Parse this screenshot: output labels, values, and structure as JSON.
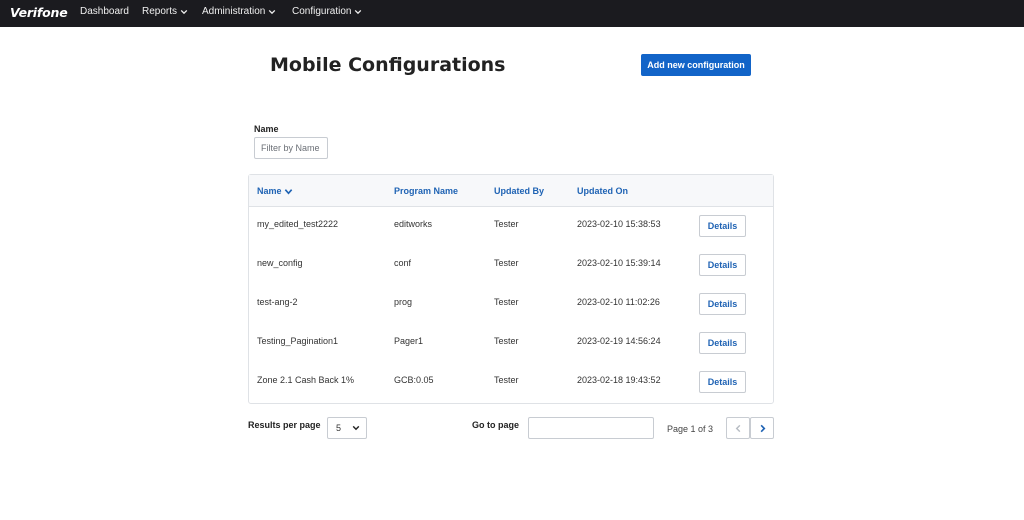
{
  "nav": {
    "logo": "Verifone",
    "items": [
      {
        "label": "Dashboard",
        "dropdown": false
      },
      {
        "label": "Reports",
        "dropdown": true
      },
      {
        "label": "Administration",
        "dropdown": true
      },
      {
        "label": "Configuration",
        "dropdown": true
      }
    ]
  },
  "header": {
    "title": "Mobile Configurations",
    "add_button": "Add new configuration"
  },
  "filter": {
    "label": "Name",
    "placeholder": "Filter by Name",
    "value": ""
  },
  "table": {
    "columns": [
      "Name",
      "Program Name",
      "Updated By",
      "Updated On"
    ],
    "sort_column": "Name",
    "sort_direction": "descending",
    "details_label": "Details",
    "rows": [
      {
        "name": "my_edited_test2222",
        "program": "editworks",
        "updated_by": "Tester",
        "updated_on": "2023-02-10 15:38:53"
      },
      {
        "name": "new_config",
        "program": "conf",
        "updated_by": "Tester",
        "updated_on": "2023-02-10 15:39:14"
      },
      {
        "name": "test-ang-2",
        "program": "prog",
        "updated_by": "Tester",
        "updated_on": "2023-02-10 11:02:26"
      },
      {
        "name": "Testing_Pagination1",
        "program": "Pager1",
        "updated_by": "Tester",
        "updated_on": "2023-02-19 14:56:24"
      },
      {
        "name": "Zone 2.1 Cash Back 1%",
        "program": "GCB:0.05",
        "updated_by": "Tester",
        "updated_on": "2023-02-18 19:43:52"
      }
    ]
  },
  "pagination": {
    "results_label": "Results per page",
    "per_page": "5",
    "goto_label": "Go to page",
    "goto_value": "",
    "page_info": "Page 1 of 3",
    "icons": {
      "prev": "chevron-left-icon",
      "next": "chevron-right-icon"
    }
  },
  "colors": {
    "nav_bg": "#1b1b1f",
    "primary": "#1264c8",
    "link": "#1f63b4"
  }
}
